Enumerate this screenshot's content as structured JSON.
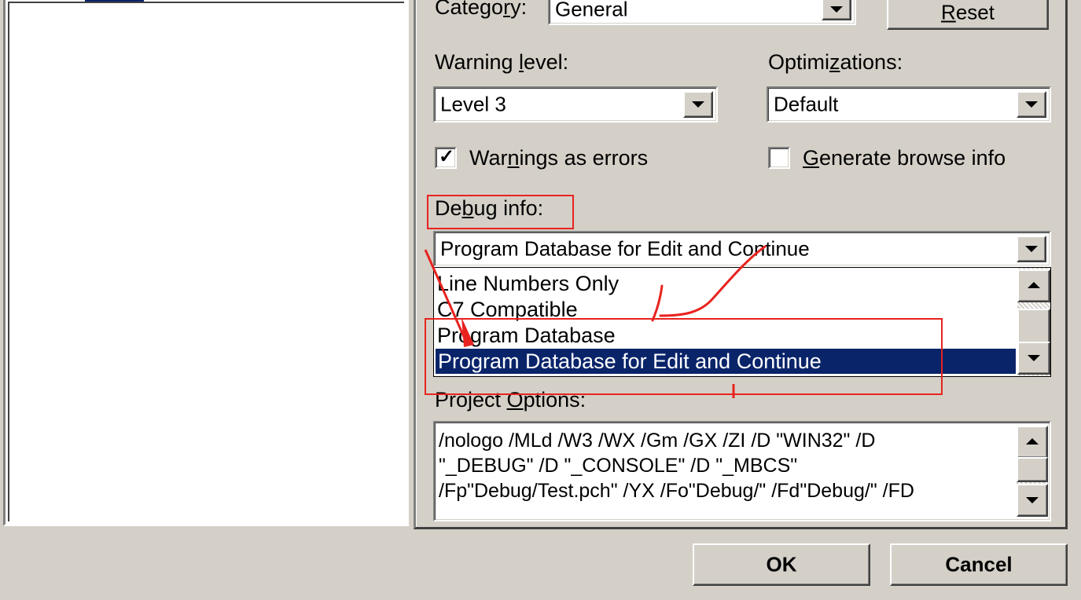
{
  "left_pane": {
    "selected_label": ""
  },
  "c_cpp_tab": {
    "category": {
      "label_pre": "Catego",
      "label_key": "r",
      "label_post": "y:",
      "value": "General"
    },
    "reset_button": {
      "key": "R",
      "rest": "eset"
    },
    "warning_level": {
      "label_pre": "Warning ",
      "label_key": "l",
      "label_post": "evel:",
      "value": "Level 3"
    },
    "optimizations": {
      "label_pre": "Optimi",
      "label_key": "z",
      "label_post": "ations:",
      "value": "Default"
    },
    "warnings_as_errors": {
      "label_pre": "War",
      "label_key": "n",
      "label_post": "ings as errors",
      "checked": true
    },
    "generate_browse_info": {
      "label_key": "G",
      "label_post": "enerate browse info",
      "checked": false
    },
    "debug_info": {
      "label_pre": "De",
      "label_key": "b",
      "label_post": "ug info:",
      "value": "Program Database for Edit and Continue",
      "options": [
        "Line Numbers Only",
        "C7 Compatible",
        "Program Database",
        "Program Database for Edit and Continue"
      ],
      "selected_index": 3
    },
    "project_options": {
      "label_pre": "Project ",
      "label_key": "O",
      "label_post": "ptions:",
      "lines": [
        "/nologo /MLd /W3 /WX /Gm /GX /ZI /D \"WIN32\" /D",
        "\"_DEBUG\" /D \"_CONSOLE\" /D \"_MBCS\"",
        "/Fp\"Debug/Test.pch\" /YX /Fo\"Debug/\" /Fd\"Debug/\" /FD"
      ]
    }
  },
  "dialog_buttons": {
    "ok": "OK",
    "cancel": "Cancel"
  },
  "annotation": {
    "color": "#e8231f",
    "mark": "I"
  },
  "colors": {
    "dialog_bg": "#d4d0c8",
    "selection": "#0a246a"
  },
  "icons": {
    "dropdown": "chevron-down-icon",
    "scroll_up": "arrow-up-icon",
    "scroll_down": "arrow-down-icon",
    "check": "check-icon"
  }
}
